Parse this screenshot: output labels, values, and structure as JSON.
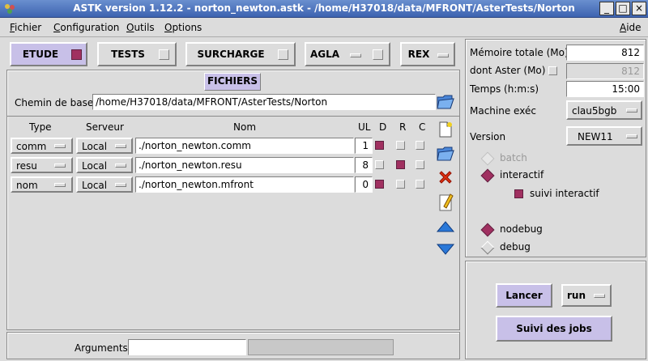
{
  "window": {
    "title": "ASTK version 1.12.2 - norton_newton.astk - /home/H37018/data/MFRONT/AsterTests/Norton",
    "minimize": "_",
    "maximize": "□",
    "close": "×"
  },
  "menu": {
    "fichier": "Fichier",
    "configuration": "Configuration",
    "outils": "Outils",
    "options": "Options",
    "aide": "Aide"
  },
  "tabs": {
    "etude": "ETUDE",
    "tests": "TESTS",
    "surcharge": "SURCHARGE",
    "agla": "AGLA",
    "rex": "REX"
  },
  "fichiers": {
    "heading": "FICHIERS",
    "base_label": "Chemin de base",
    "base_path": "/home/H37018/data/MFRONT/AsterTests/Norton",
    "headers": {
      "type": "Type",
      "server": "Serveur",
      "name": "Nom",
      "ul": "UL",
      "d": "D",
      "r": "R",
      "c": "C"
    },
    "rows": [
      {
        "type": "comm",
        "server": "Local",
        "name": "./norton_newton.comm",
        "ul": "1",
        "d": true,
        "r": false,
        "c": false
      },
      {
        "type": "resu",
        "server": "Local",
        "name": "./norton_newton.resu",
        "ul": "8",
        "d": false,
        "r": true,
        "c": false
      },
      {
        "type": "nom",
        "server": "Local",
        "name": "./norton_newton.mfront",
        "ul": "0",
        "d": true,
        "r": false,
        "c": false
      }
    ]
  },
  "arguments": {
    "label": "Arguments",
    "value": ""
  },
  "params": {
    "memoire_label": "Mémoire totale (Mo)",
    "memoire_value": "812",
    "aster_label": "dont Aster (Mo)",
    "aster_value": "812",
    "temps_label": "Temps (h:m:s)",
    "temps_value": "15:00",
    "machine_label": "Machine exéc",
    "machine_value": "clau5bgb",
    "version_label": "Version",
    "version_value": "NEW11"
  },
  "modes": {
    "batch": "batch",
    "interactif": "interactif",
    "suivi": "suivi interactif",
    "nodebug": "nodebug",
    "debug": "debug"
  },
  "actions": {
    "lancer": "Lancer",
    "run": "run",
    "suivi_jobs": "Suivi des jobs"
  },
  "colors": {
    "accent": "#a03060",
    "button_active": "#c8c0e8",
    "titlebar": "#3d63b0"
  }
}
